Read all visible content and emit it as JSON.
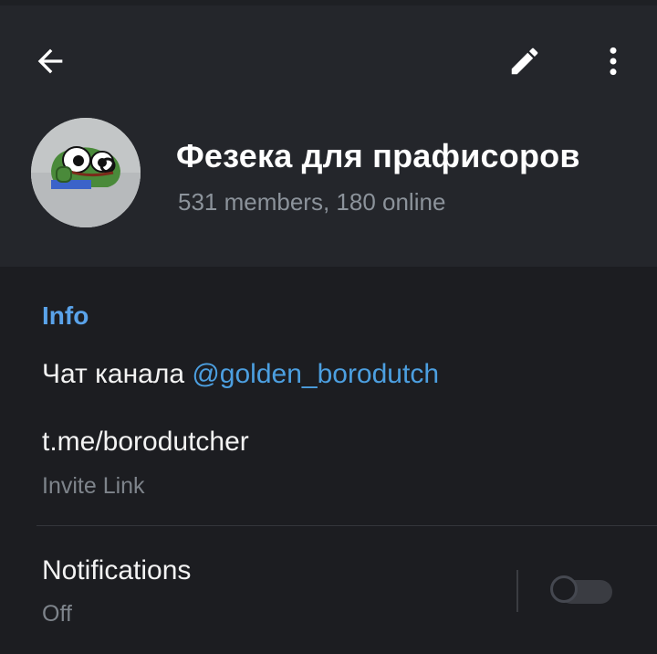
{
  "header": {
    "title": "Фезека для прафисоров",
    "subtitle": "531 members, 180 online",
    "back_icon": "arrow-left-icon",
    "edit_icon": "pencil-icon",
    "more_icon": "more-vert-icon"
  },
  "info": {
    "section_title": "Info",
    "description_prefix": "Чат канала ",
    "description_link": "@golden_borodutch",
    "invite_link": "t.me/borodutcher",
    "invite_label": "Invite Link"
  },
  "notifications": {
    "label": "Notifications",
    "value": "Off",
    "enabled": false
  },
  "colors": {
    "accent": "#5aa3ea",
    "link": "#4c9fe0",
    "header_bg": "#24262b",
    "body_bg": "#1c1d21"
  }
}
